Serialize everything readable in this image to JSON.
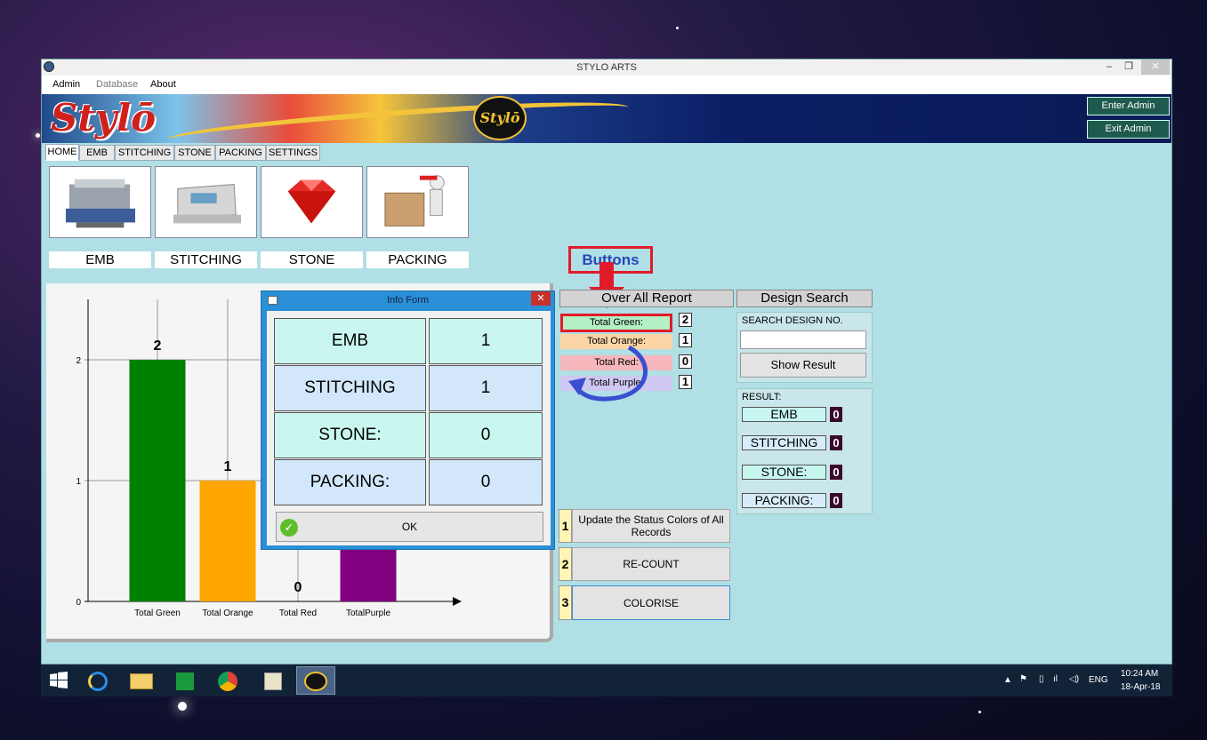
{
  "window": {
    "title": "STYLO ARTS",
    "controls": [
      "–",
      "❐",
      "✕"
    ]
  },
  "menu": [
    "Admin",
    "Database",
    "About"
  ],
  "banner": {
    "logo_big": "Stylō",
    "logo_small": "Stylō",
    "enter_admin": "Enter Admin",
    "exit_admin": "Exit Admin"
  },
  "tabs": [
    "HOME",
    "EMB",
    "STITCHING",
    "STONE",
    "PACKING",
    "SETTINGS"
  ],
  "tiles": [
    "EMB",
    "STITCHING",
    "STONE",
    "PACKING"
  ],
  "callout": "Buttons",
  "overall_report": "Over All Report",
  "design_search": "Design Search",
  "status": [
    {
      "label": "Total Green:",
      "count": "2",
      "color": "#b3f0c4"
    },
    {
      "label": "Total Orange:",
      "count": "1",
      "color": "#fcd5a7"
    },
    {
      "label": "Total Red:",
      "count": "0",
      "color": "#f6b7bd"
    },
    {
      "label": "Total Purple:",
      "count": "1",
      "color": "#cfc8f2"
    }
  ],
  "search": {
    "label": "SEARCH DESIGN NO.",
    "value": "",
    "button": "Show Result"
  },
  "result": {
    "label": "RESULT:",
    "items": [
      {
        "label": "EMB",
        "value": "0"
      },
      {
        "label": "STITCHING",
        "value": "0"
      },
      {
        "label": "STONE:",
        "value": "0"
      },
      {
        "label": "PACKING:",
        "value": "0"
      }
    ]
  },
  "actions": [
    {
      "num": "1",
      "label": "Update the Status Colors of All Records"
    },
    {
      "num": "2",
      "label": "RE-COUNT"
    },
    {
      "num": "3",
      "label": "COLORISE"
    }
  ],
  "dialog": {
    "title": "Info Form",
    "close": "✕",
    "rows": [
      {
        "label": "EMB",
        "value": "1"
      },
      {
        "label": "STITCHING",
        "value": "1"
      },
      {
        "label": "STONE:",
        "value": "0"
      },
      {
        "label": "PACKING:",
        "value": "0"
      }
    ],
    "ok": "OK"
  },
  "chart_data": {
    "type": "bar",
    "categories": [
      "Total Green",
      "Total Orange",
      "Total Red",
      "TotalPurple"
    ],
    "values": [
      2,
      1,
      0,
      1
    ],
    "colors": [
      "#008000",
      "#ffa500",
      "#ff0000",
      "#800080"
    ],
    "data_labels": [
      "2",
      "1",
      "0",
      "1"
    ],
    "ylim": [
      0,
      2.5
    ],
    "yticks": [
      0,
      1,
      2
    ],
    "grid": true
  },
  "taskbar": {
    "lang": "ENG",
    "time": "10:24 AM",
    "date": "18-Apr-18"
  }
}
